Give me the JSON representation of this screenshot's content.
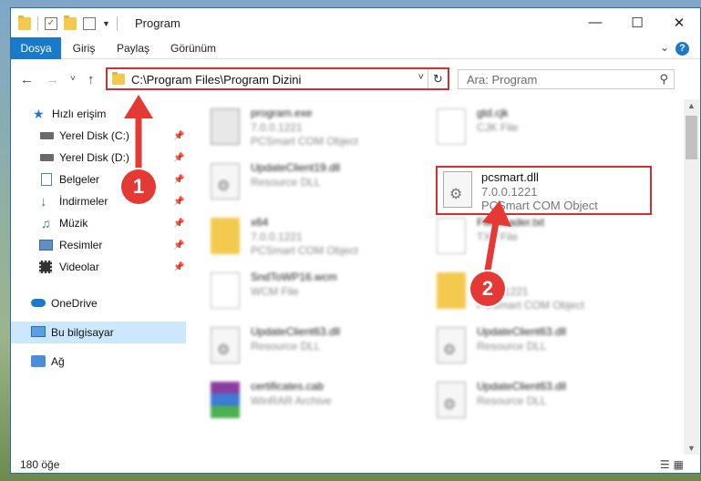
{
  "title": "Program",
  "ribbon": {
    "tabs": [
      "Dosya",
      "Giriş",
      "Paylaş",
      "Görünüm"
    ]
  },
  "address": {
    "path": "C:\\Program Files\\Program Dizini"
  },
  "search": {
    "placeholder": "Ara: Program"
  },
  "sidebar": {
    "items": [
      {
        "label": "Hızlı erişim",
        "icon": "star-icon"
      },
      {
        "label": "Yerel Disk (C:)",
        "icon": "drive-icon"
      },
      {
        "label": "Yerel Disk (D:)",
        "icon": "drive-icon"
      },
      {
        "label": "Belgeler",
        "icon": "documents-icon"
      },
      {
        "label": "İndirmeler",
        "icon": "download-icon"
      },
      {
        "label": "Müzik",
        "icon": "music-icon"
      },
      {
        "label": "Resimler",
        "icon": "pictures-icon"
      },
      {
        "label": "Videolar",
        "icon": "video-icon"
      },
      {
        "label": "OneDrive",
        "icon": "cloud-icon"
      },
      {
        "label": "Bu bilgisayar",
        "icon": "computer-icon"
      },
      {
        "label": "Ağ",
        "icon": "network-icon"
      }
    ]
  },
  "files": [
    {
      "name": "program.exe",
      "line1": "7.0.0.1221",
      "line2": "PCSmart COM Object"
    },
    {
      "name": "gtd.cjk",
      "line1": "CJK File",
      "line2": ""
    },
    {
      "name": "UpdateClient19.dll",
      "line1": "Resource DLL",
      "line2": ""
    },
    {
      "name": "x64",
      "line1": "7.0.0.1221",
      "line2": "PCSmart COM Object"
    },
    {
      "name": "FileReader.txt",
      "line1": "TXT File",
      "line2": ""
    },
    {
      "name": "SndToWP16.wcm",
      "line1": "WCM File",
      "line2": ""
    },
    {
      "name": "",
      "line1": "7.0.0.1221",
      "line2": "PCSmart COM Object"
    },
    {
      "name": "UpdateClient63.dll",
      "line1": "Resource DLL",
      "line2": ""
    },
    {
      "name": "UpdateClient63.dll",
      "line1": "Resource DLL",
      "line2": ""
    },
    {
      "name": "certificates.cab",
      "line1": "WinRAR Archive",
      "line2": ""
    },
    {
      "name": "UpdateClient63.dll",
      "line1": "Resource DLL",
      "line2": ""
    }
  ],
  "selected_file": {
    "name": "pcsmart.dll",
    "version": "7.0.0.1221",
    "description": "PCSmart COM Object"
  },
  "status": {
    "count": "180 öğe"
  },
  "callouts": [
    "1",
    "2"
  ],
  "colors": {
    "accent": "#1979ca",
    "highlight": "#d32f2f",
    "callout": "#e53935",
    "selection": "#cce8ff"
  }
}
